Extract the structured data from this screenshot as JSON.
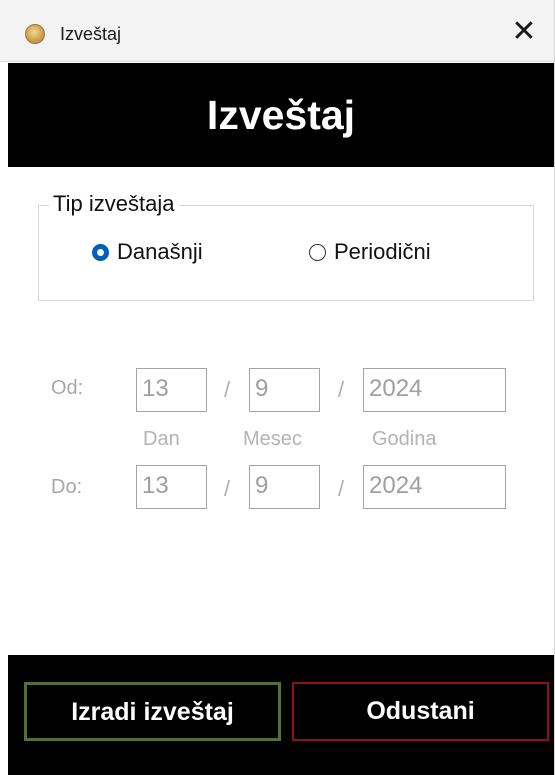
{
  "window": {
    "title": "Izveštaj",
    "close_glyph": "✕",
    "icon": "coin-app-icon"
  },
  "header": {
    "title": "Izveštaj"
  },
  "report_type": {
    "legend": "Tip izveštaja",
    "options": [
      {
        "label": "Današnji",
        "selected": true
      },
      {
        "label": "Periodični",
        "selected": false
      }
    ]
  },
  "date_range": {
    "from": {
      "label": "Od:",
      "day": "13",
      "month": "9",
      "year": "2024"
    },
    "to": {
      "label": "Do:",
      "day": "13",
      "month": "9",
      "year": "2024"
    },
    "separator": "/",
    "hints": {
      "day": "Dan",
      "month": "Mesec",
      "year": "Godina"
    }
  },
  "footer": {
    "create_label": "Izradi izveštaj",
    "cancel_label": "Odustani"
  },
  "colors": {
    "header_bg": "#000000",
    "radio_accent": "#005fb8",
    "create_border": "#566d36",
    "cancel_border": "#8d1414"
  }
}
